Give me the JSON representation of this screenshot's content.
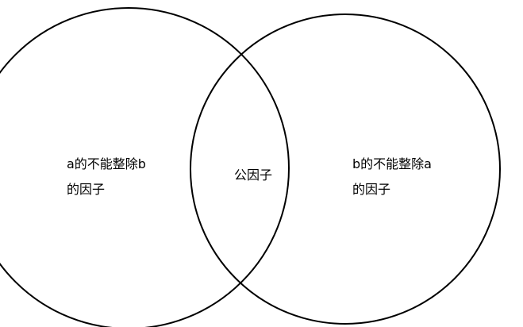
{
  "diagram": {
    "type": "venn",
    "colors": {
      "stroke": "#000000",
      "background": "#ffffff"
    },
    "regions": {
      "left_only": {
        "line1": "a的不能整除b",
        "line2": "的因子"
      },
      "intersection": {
        "text": "公因子"
      },
      "right_only": {
        "line1": "b的不能整除a",
        "line2": "的因子"
      }
    }
  }
}
